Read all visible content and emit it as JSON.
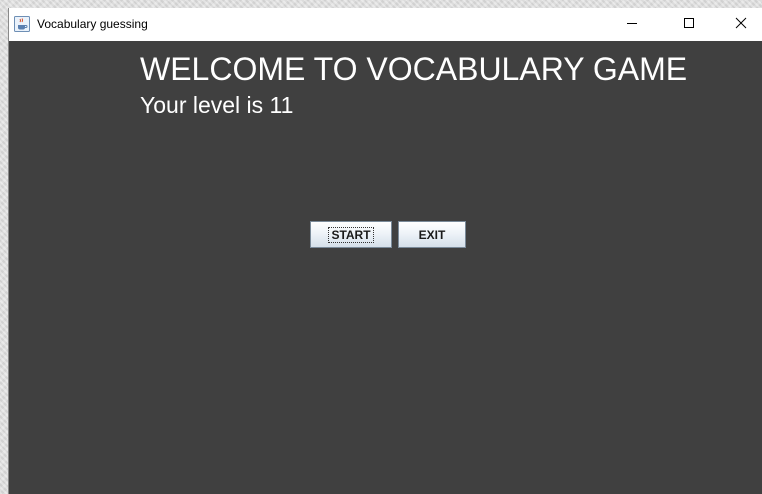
{
  "window": {
    "title": "Vocabulary guessing",
    "icon": "java-cup-icon",
    "controls": {
      "minimize": "minimize-icon",
      "maximize": "maximize-icon",
      "close": "close-icon"
    }
  },
  "main": {
    "welcome_text": "WELCOME TO VOCABULARY GAME",
    "level_text": "Your level is 11",
    "start_label": "START",
    "exit_label": "EXIT"
  },
  "colors": {
    "background": "#404040",
    "text": "#ffffff",
    "titlebar": "#ffffff"
  }
}
